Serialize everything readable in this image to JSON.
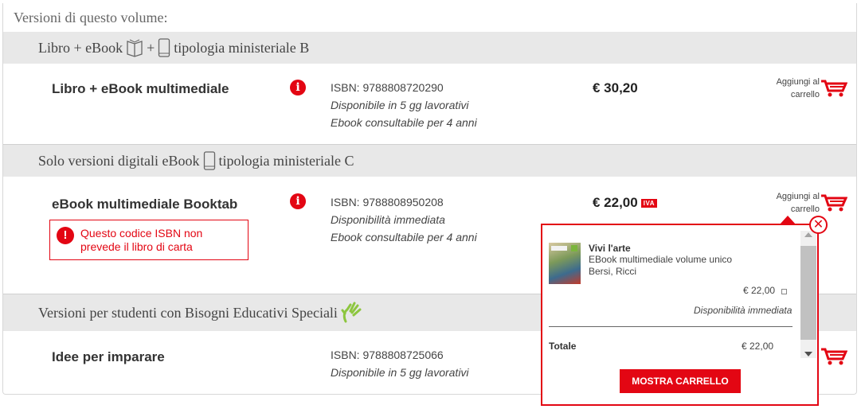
{
  "panel_title": "Versioni di questo volume:",
  "section1": {
    "label_pre": "Libro + eBook",
    "plus": "+",
    "label_post": "tipologia ministeriale B"
  },
  "product1": {
    "name": "Libro + eBook multimediale",
    "isbn": "ISBN: 9788808720290",
    "availability": "Disponibile in 5 gg lavorativi",
    "ebook_duration": "Ebook consultabile per 4 anni",
    "price": "€ 30,20",
    "add_line1": "Aggiungi al",
    "add_line2": "carrello"
  },
  "section2": {
    "label_pre": "Solo versioni digitali eBook",
    "label_post": "tipologia ministeriale C"
  },
  "product2": {
    "name": "eBook multimediale Booktab",
    "isbn": "ISBN: 9788808950208",
    "availability": "Disponibilità immediata",
    "ebook_duration": "Ebook consultabile per 4 anni",
    "price": "€ 22,00",
    "iva_badge": "IVA",
    "add_line1": "Aggiungi al",
    "add_line2": "carrello",
    "warning_line1": "Questo codice ISBN non",
    "warning_line2": "prevede il libro di carta"
  },
  "section3": {
    "label": "Versioni per studenti con Bisogni Educativi Speciali"
  },
  "product3": {
    "name": "Idee per imparare",
    "isbn": "ISBN: 9788808725066",
    "availability": "Disponibile in 5 gg lavorativi"
  },
  "cart_popup": {
    "item_title": "Vivi l'arte",
    "item_subtitle": "EBook multimediale volume unico",
    "item_authors": "Bersi, Ricci",
    "item_price": "€ 22,00",
    "item_availability": "Disponibilità immediata",
    "total_label": "Totale",
    "total_value": "€ 22,00",
    "button_label": "MOSTRA CARRELLO",
    "close_symbol": "✕"
  },
  "colors": {
    "accent": "#e30613",
    "band": "#e8e8e8",
    "bes_icon": "#8dc63f"
  },
  "icons": [
    "book-icon",
    "phone-icon",
    "info-icon",
    "cart-icon",
    "hand-icon",
    "close-icon",
    "warning-icon"
  ]
}
